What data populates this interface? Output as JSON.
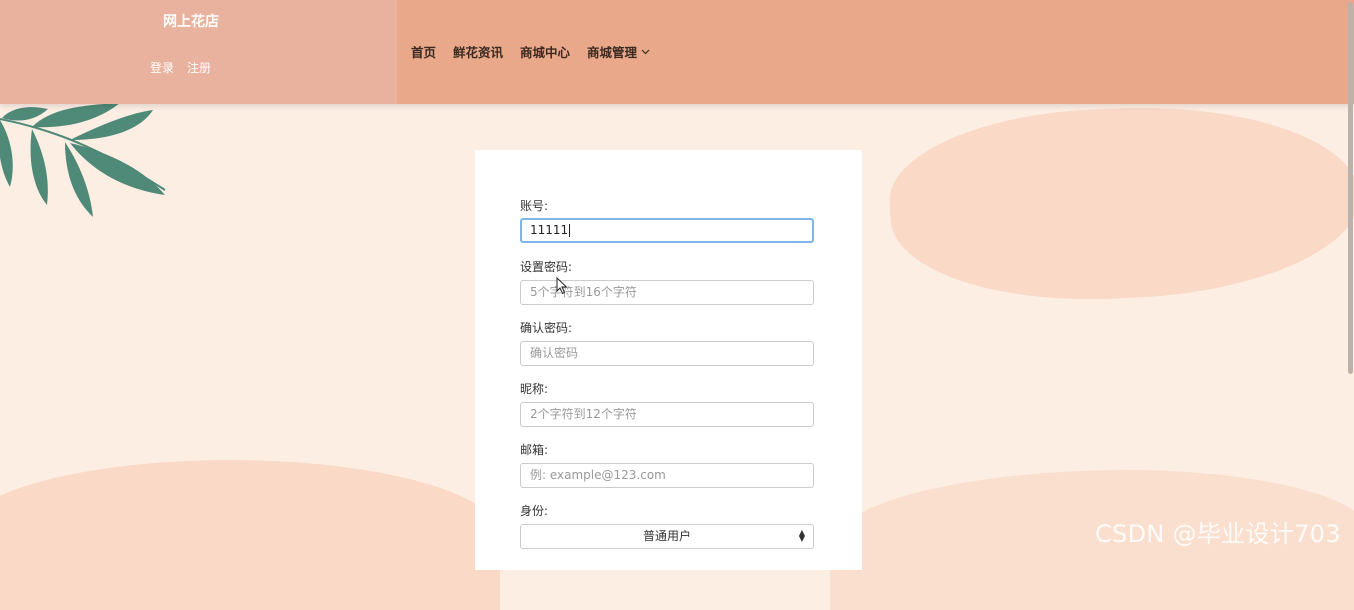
{
  "header": {
    "site_title": "网上花店",
    "login_label": "登录",
    "register_label": "注册",
    "nav": [
      "首页",
      "鲜花资讯",
      "商城中心",
      "商城管理"
    ]
  },
  "form": {
    "account": {
      "label": "账号:",
      "value": "11111"
    },
    "password": {
      "label": "设置密码:",
      "placeholder": "5个字符到16个字符"
    },
    "confirm_password": {
      "label": "确认密码:",
      "placeholder": "确认密码"
    },
    "nickname": {
      "label": "昵称:",
      "placeholder": "2个字符到12个字符"
    },
    "email": {
      "label": "邮箱:",
      "placeholder": "例: example@123.com"
    },
    "role": {
      "label": "身份:",
      "selected": "普通用户"
    }
  },
  "watermark": "CSDN @毕业设计703",
  "colors": {
    "header_left": "#e8b29e",
    "header_right": "#e9a889",
    "background": "#fdeee4",
    "leaf": "#4f8a78",
    "focus_border": "#7eb6ea"
  },
  "icons": {
    "nav_dropdown": "chevron-down-icon",
    "select_arrows": "sort-arrows-icon",
    "pointer": "mouse-cursor-icon",
    "decoration": "leaf-branch-icon"
  }
}
